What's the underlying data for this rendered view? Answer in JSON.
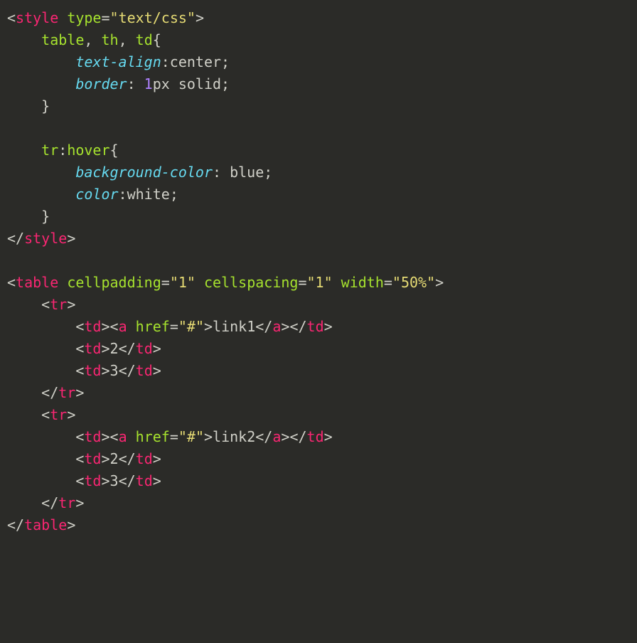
{
  "code": {
    "tokens": [
      [
        [
          "b",
          "<"
        ],
        [
          "tag",
          "style"
        ],
        [
          "b",
          " "
        ],
        [
          "attr",
          "type"
        ],
        [
          "b",
          "="
        ],
        [
          "str",
          "\"text/css\""
        ],
        [
          "b",
          ">"
        ]
      ],
      [
        [
          "b",
          "    "
        ],
        [
          "sel",
          "table"
        ],
        [
          "b",
          ", "
        ],
        [
          "sel",
          "th"
        ],
        [
          "b",
          ", "
        ],
        [
          "sel",
          "td"
        ],
        [
          "b",
          "{"
        ]
      ],
      [
        [
          "b",
          "        "
        ],
        [
          "prop",
          "text-align"
        ],
        [
          "b",
          ":"
        ],
        [
          "val",
          "center"
        ],
        [
          "b",
          ";"
        ]
      ],
      [
        [
          "b",
          "        "
        ],
        [
          "prop",
          "border"
        ],
        [
          "b",
          ": "
        ],
        [
          "num",
          "1"
        ],
        [
          "val",
          "px solid"
        ],
        [
          "b",
          ";"
        ]
      ],
      [
        [
          "b",
          "    }"
        ]
      ],
      [
        [
          "b",
          ""
        ]
      ],
      [
        [
          "b",
          "    "
        ],
        [
          "sel",
          "tr"
        ],
        [
          "b",
          ":"
        ],
        [
          "sel",
          "hover"
        ],
        [
          "b",
          "{"
        ]
      ],
      [
        [
          "b",
          "        "
        ],
        [
          "prop",
          "background-color"
        ],
        [
          "b",
          ": "
        ],
        [
          "val",
          "blue"
        ],
        [
          "b",
          ";"
        ]
      ],
      [
        [
          "b",
          "        "
        ],
        [
          "prop",
          "color"
        ],
        [
          "b",
          ":"
        ],
        [
          "val",
          "white"
        ],
        [
          "b",
          ";"
        ]
      ],
      [
        [
          "b",
          "    }"
        ]
      ],
      [
        [
          "b",
          "</"
        ],
        [
          "tag",
          "style"
        ],
        [
          "b",
          ">"
        ]
      ],
      [
        [
          "b",
          ""
        ]
      ],
      [
        [
          "b",
          "<"
        ],
        [
          "tag",
          "table"
        ],
        [
          "b",
          " "
        ],
        [
          "attr",
          "cellpadding"
        ],
        [
          "b",
          "="
        ],
        [
          "str",
          "\"1\""
        ],
        [
          "b",
          " "
        ],
        [
          "attr",
          "cellspacing"
        ],
        [
          "b",
          "="
        ],
        [
          "str",
          "\"1\""
        ],
        [
          "b",
          " "
        ],
        [
          "attr",
          "width"
        ],
        [
          "b",
          "="
        ],
        [
          "str",
          "\"50%\""
        ],
        [
          "b",
          ">"
        ]
      ],
      [
        [
          "b",
          "    <"
        ],
        [
          "tag",
          "tr"
        ],
        [
          "b",
          ">"
        ]
      ],
      [
        [
          "b",
          "        <"
        ],
        [
          "tag",
          "td"
        ],
        [
          "b",
          "><"
        ],
        [
          "tag",
          "a"
        ],
        [
          "b",
          " "
        ],
        [
          "attr",
          "href"
        ],
        [
          "b",
          "="
        ],
        [
          "str",
          "\"#\""
        ],
        [
          "b",
          ">"
        ],
        [
          "txt",
          "link1"
        ],
        [
          "b",
          "</"
        ],
        [
          "tag",
          "a"
        ],
        [
          "b",
          "></"
        ],
        [
          "tag",
          "td"
        ],
        [
          "b",
          ">"
        ]
      ],
      [
        [
          "b",
          "        <"
        ],
        [
          "tag",
          "td"
        ],
        [
          "b",
          ">"
        ],
        [
          "txt",
          "2"
        ],
        [
          "b",
          "</"
        ],
        [
          "tag",
          "td"
        ],
        [
          "b",
          ">"
        ]
      ],
      [
        [
          "b",
          "        <"
        ],
        [
          "tag",
          "td"
        ],
        [
          "b",
          ">"
        ],
        [
          "txt",
          "3"
        ],
        [
          "b",
          "</"
        ],
        [
          "tag",
          "td"
        ],
        [
          "b",
          ">"
        ]
      ],
      [
        [
          "b",
          "    </"
        ],
        [
          "tag",
          "tr"
        ],
        [
          "b",
          ">"
        ]
      ],
      [
        [
          "b",
          "    <"
        ],
        [
          "tag",
          "tr"
        ],
        [
          "b",
          ">"
        ]
      ],
      [
        [
          "b",
          "        <"
        ],
        [
          "tag",
          "td"
        ],
        [
          "b",
          "><"
        ],
        [
          "tag",
          "a"
        ],
        [
          "b",
          " "
        ],
        [
          "attr",
          "href"
        ],
        [
          "b",
          "="
        ],
        [
          "str",
          "\"#\""
        ],
        [
          "b",
          ">"
        ],
        [
          "txt",
          "link2"
        ],
        [
          "b",
          "</"
        ],
        [
          "tag",
          "a"
        ],
        [
          "b",
          "></"
        ],
        [
          "tag",
          "td"
        ],
        [
          "b",
          ">"
        ]
      ],
      [
        [
          "b",
          "        <"
        ],
        [
          "tag",
          "td"
        ],
        [
          "b",
          ">"
        ],
        [
          "txt",
          "2"
        ],
        [
          "b",
          "</"
        ],
        [
          "tag",
          "td"
        ],
        [
          "b",
          ">"
        ]
      ],
      [
        [
          "b",
          "        <"
        ],
        [
          "tag",
          "td"
        ],
        [
          "b",
          ">"
        ],
        [
          "txt",
          "3"
        ],
        [
          "b",
          "</"
        ],
        [
          "tag",
          "td"
        ],
        [
          "b",
          ">"
        ]
      ],
      [
        [
          "b",
          "    </"
        ],
        [
          "tag",
          "tr"
        ],
        [
          "b",
          ">"
        ]
      ],
      [
        [
          "b",
          "</"
        ],
        [
          "tag",
          "table"
        ],
        [
          "b",
          ">"
        ]
      ]
    ]
  }
}
